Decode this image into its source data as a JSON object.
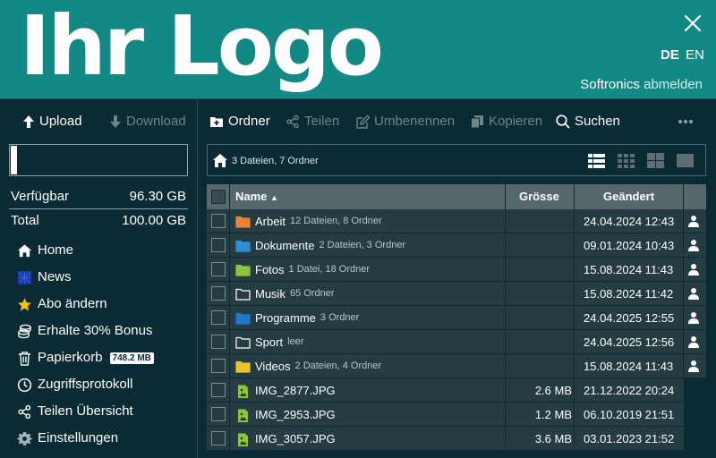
{
  "header": {
    "logo_text": "Ihr Logo",
    "languages": [
      "DE",
      "EN"
    ],
    "active_language": "DE",
    "account_name": "Softronics",
    "logout_label": "abmelden",
    "bg_color": "#138985"
  },
  "sidebar": {
    "upload_label": "Upload",
    "download_label": "Download",
    "quota_used_fraction": 0.037,
    "available_label": "Verfügbar",
    "available_value": "96.30 GB",
    "total_label": "Total",
    "total_value": "100.00 GB",
    "nav": [
      {
        "label": "Home",
        "icon": "home-icon"
      },
      {
        "label": "News",
        "icon": "news-icon"
      },
      {
        "label": "Abo ändern",
        "icon": "star-icon"
      },
      {
        "label": "Erhalte 30% Bonus",
        "icon": "coins-icon"
      },
      {
        "label": "Papierkorb",
        "icon": "trash-icon",
        "badge": "748.2 MB"
      },
      {
        "label": "Zugriffsprotokoll",
        "icon": "clock-icon"
      },
      {
        "label": "Teilen Übersicht",
        "icon": "share-icon"
      },
      {
        "label": "Einstellungen",
        "icon": "gear-icon"
      }
    ]
  },
  "toolbar": {
    "new_folder_label": "Ordner",
    "share_label": "Teilen",
    "rename_label": "Umbenennen",
    "copy_label": "Kopieren",
    "search_label": "Suchen"
  },
  "breadcrumb": {
    "summary": "3 Dateien, 7 Ordner"
  },
  "table": {
    "columns": {
      "name": "Name",
      "size": "Grösse",
      "modified": "Geändert"
    },
    "rows": [
      {
        "type": "folder",
        "name": "Arbeit",
        "meta": "12 Dateien, 8 Ordner",
        "size": "",
        "modified": "24.04.2024 12:43",
        "color": "#e8843a"
      },
      {
        "type": "folder",
        "name": "Dokumente",
        "meta": "2 Dateien, 3 Ordner",
        "size": "",
        "modified": "09.01.2024 10:43",
        "color": "#2d8fd5"
      },
      {
        "type": "folder",
        "name": "Fotos",
        "meta": "1 Datei, 18 Ordner",
        "size": "",
        "modified": "15.08.2024 11:43",
        "color": "#8cc63f"
      },
      {
        "type": "folder",
        "name": "Musik",
        "meta": "65 Ordner",
        "size": "",
        "modified": "15.08.2024 11:42",
        "color": "outline"
      },
      {
        "type": "folder",
        "name": "Programme",
        "meta": "3 Ordner",
        "size": "",
        "modified": "24.04.2025 12:55",
        "color": "#1f78c8"
      },
      {
        "type": "folder",
        "name": "Sport",
        "meta": "leer",
        "size": "",
        "modified": "24.04.2025 12:56",
        "color": "outline"
      },
      {
        "type": "folder",
        "name": "Videos",
        "meta": "2 Dateien, 4 Ordner",
        "size": "",
        "modified": "15.08.2024 11:43",
        "color": "#e8c531"
      },
      {
        "type": "file",
        "name": "IMG_2877.JPG",
        "meta": "",
        "size": "2.6 MB",
        "modified": "21.12.2022 20:24",
        "color": "#8cc63f"
      },
      {
        "type": "file",
        "name": "IMG_2953.JPG",
        "meta": "",
        "size": "1.2 MB",
        "modified": "06.10.2019 21:51",
        "color": "#8cc63f"
      },
      {
        "type": "file",
        "name": "IMG_3057.JPG",
        "meta": "",
        "size": "3.6 MB",
        "modified": "03.01.2023 21:52",
        "color": "#8cc63f"
      }
    ]
  }
}
